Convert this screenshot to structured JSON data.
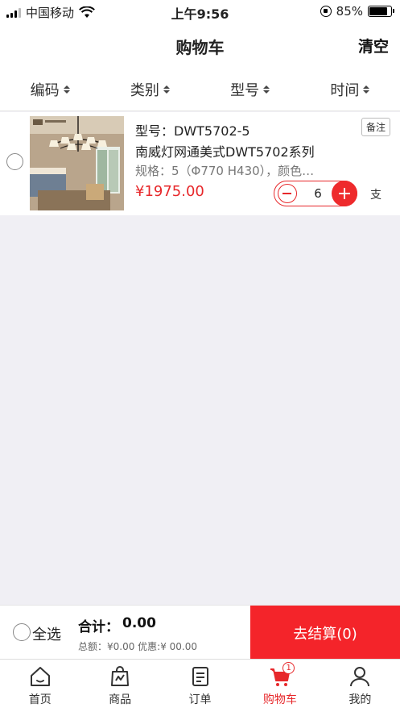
{
  "status_bar": {
    "carrier": "中国移动",
    "time": "上午9:56",
    "battery_percent": "85%",
    "battery_level": 0.85
  },
  "header": {
    "title": "购物车",
    "clear_label": "清空"
  },
  "sort_bar": {
    "items": [
      {
        "label": "编码"
      },
      {
        "label": "类别"
      },
      {
        "label": "型号"
      },
      {
        "label": "时间"
      }
    ]
  },
  "cart": {
    "items": [
      {
        "model": "型号：DWT5702-5",
        "note_label": "备注",
        "name": "南威灯网通美式DWT5702系列",
        "spec": "规格：5（Φ770 H430），颜色…",
        "price": "¥1975.00",
        "quantity": "6",
        "unit": "支"
      }
    ]
  },
  "checkout": {
    "select_all_label": "全选",
    "total_label": "合计：",
    "total_value": "0.00",
    "detail": "总额：¥0.00 优惠:¥ 00.00",
    "button_label": "去结算(0)"
  },
  "tabbar": {
    "items": [
      {
        "label": "首页",
        "icon": "home-icon"
      },
      {
        "label": "商品",
        "icon": "shopping-bag-icon"
      },
      {
        "label": "订单",
        "icon": "order-list-icon"
      },
      {
        "label": "购物车",
        "icon": "cart-icon",
        "badge": "1"
      },
      {
        "label": "我的",
        "icon": "user-icon"
      }
    ],
    "active_index": 3
  },
  "colors": {
    "accent": "#e7282b",
    "checkout_button": "#f4242a",
    "page_background": "#f0eff4"
  }
}
